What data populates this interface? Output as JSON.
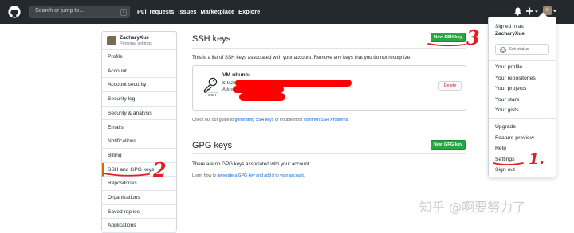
{
  "header": {
    "search_placeholder": "Search or jump to...",
    "search_shortcut": "/",
    "nav": [
      "Pull requests",
      "Issues",
      "Marketplace",
      "Explore"
    ],
    "icons": [
      "github-logo",
      "bell-icon",
      "plus-icon",
      "avatar"
    ]
  },
  "dropdown": {
    "signed_in_as": "Signed in as",
    "username": "ZacharyXue",
    "set_status": "Set status",
    "group1": [
      "Your profile",
      "Your repositories",
      "Your projects",
      "Your stars",
      "Your gists"
    ],
    "group2": [
      "Upgrade",
      "Feature preview",
      "Help",
      "Settings",
      "Sign out"
    ]
  },
  "sidebar": {
    "name": "ZacharyXue",
    "subtitle": "Personal settings",
    "items": [
      "Profile",
      "Account",
      "Account security",
      "Security log",
      "Security & analysis",
      "Emails",
      "Notifications",
      "Billing",
      "SSH and GPG keys",
      "Repositories",
      "Organizations",
      "Saved replies",
      "Applications"
    ],
    "active_item": "SSH and GPG keys"
  },
  "ssh": {
    "title": "SSH keys",
    "new_button": "New SSH key",
    "description": "This is a list of SSH keys associated with your account. Remove any keys that you do not recognize.",
    "key": {
      "title": "VM ubuntu",
      "sha_prefix": "SHA256",
      "added_prefix": "Added",
      "badge": "SSH",
      "delete_label": "Delete"
    },
    "footer_prefix": "Check out our guide to ",
    "footer_link1": "generating SSH keys",
    "footer_mid": " or troubleshoot ",
    "footer_link2": "common SSH Problems",
    "footer_suffix": "."
  },
  "gpg": {
    "title": "GPG keys",
    "new_button": "New GPG key",
    "description": "There are no GPG keys associated with your account.",
    "footer_prefix": "Learn how to ",
    "footer_link": "generate a GPG key and add it to your account",
    "footer_suffix": "."
  },
  "annotations": {
    "step1": "1.",
    "step2": "2",
    "step3": "3",
    "color": "#e02020"
  },
  "watermark": "知乎 @啊要努力了",
  "colors": {
    "topbar": "#24292e",
    "primary_button": "#28a745",
    "link": "#0366d6",
    "active_accent": "#e36209",
    "danger": "#cb2431"
  }
}
